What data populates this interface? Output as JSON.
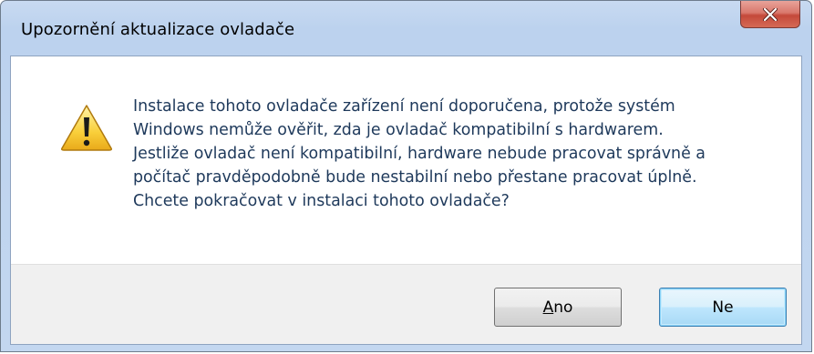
{
  "window": {
    "title": "Upozornění aktualizace ovladače",
    "close_icon": "close-icon"
  },
  "message": {
    "icon": "warning-icon",
    "lines": [
      "Instalace tohoto ovladače zařízení není doporučena, protože systém",
      "Windows nemůže ověřit, zda je ovladač kompatibilní s hardwarem.",
      "Jestliže ovladač není kompatibilní, hardware nebude pracovat správně a",
      "počítač pravděpodobně bude nestabilní nebo přestane pracovat úplně.",
      "Chcete pokračovat v instalaci tohoto ovladače?"
    ]
  },
  "buttons": {
    "yes_label": "Ano",
    "no_label": "Ne"
  },
  "colors": {
    "title_bar": "#c3d7f0",
    "message_text": "#1e395b",
    "footer": "#f0f0f0",
    "close_button": "#c4493a",
    "default_button_border": "#3c7fb1"
  }
}
